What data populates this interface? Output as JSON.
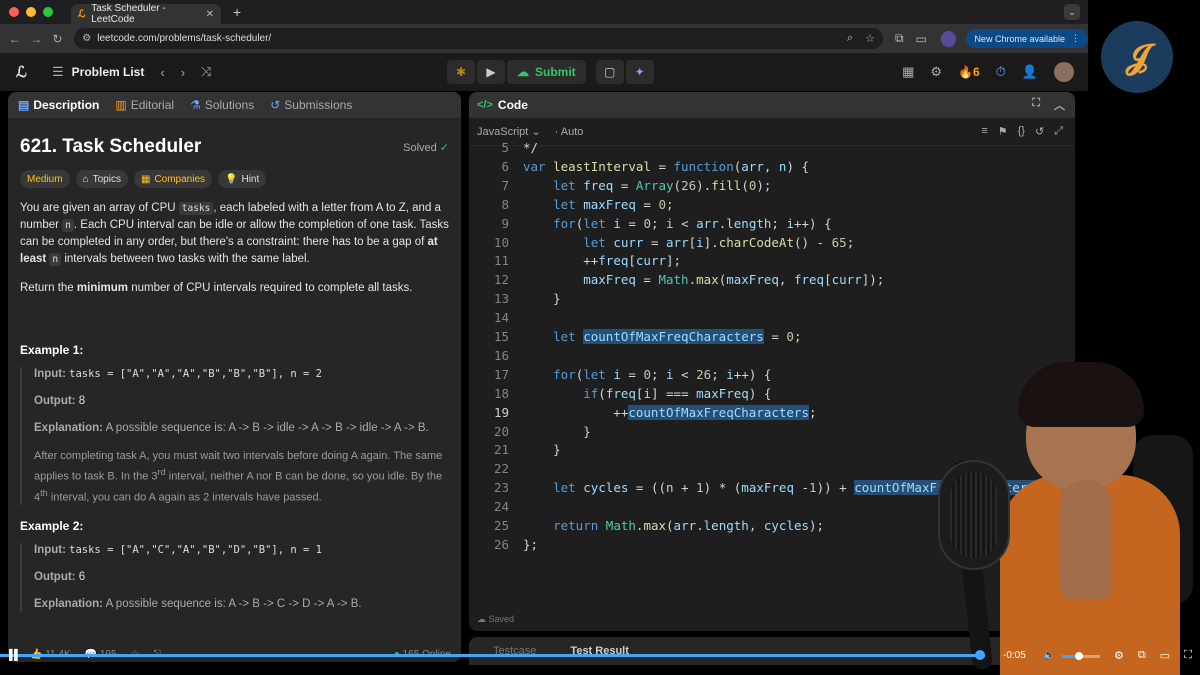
{
  "browser": {
    "tab_title": "Task Scheduler - LeetCode",
    "url": "leetcode.com/problems/task-scheduler/",
    "update_label": "New Chrome available"
  },
  "header": {
    "problem_list_label": "Problem List",
    "submit_label": "Submit",
    "streak_count": "6"
  },
  "left_tabs": [
    "Description",
    "Editorial",
    "Solutions",
    "Submissions"
  ],
  "problem": {
    "title": "621. Task Scheduler",
    "status": "Solved",
    "difficulty": "Medium",
    "topics_label": "Topics",
    "companies_label": "Companies",
    "hint_label": "Hint",
    "p1_a": "You are given an array of CPU ",
    "p1_code1": "tasks",
    "p1_b": ", each labeled with a letter from A to Z, and a number ",
    "p1_code2": "n",
    "p1_c": ". Each CPU interval can be idle or allow the completion of one task. Tasks can be completed in any order, but there's a constraint: there has to be a gap of ",
    "p1_bold": "at least",
    "p1_code3": "n",
    "p1_d": " intervals between two tasks with the same label.",
    "p2_a": "Return the ",
    "p2_bold": "minimum",
    "p2_b": " number of CPU intervals required to complete all tasks.",
    "ex1_head": "Example 1:",
    "ex1_input_label": "Input:",
    "ex1_input": "tasks = [\"A\",\"A\",\"A\",\"B\",\"B\",\"B\"], n = 2",
    "ex1_output_label": "Output:",
    "ex1_output": "8",
    "ex1_expl_label": "Explanation:",
    "ex1_expl": "A possible sequence is: A -> B -> idle -> A -> B -> idle -> A -> B.",
    "ex1_para_a": "After completing task A, you must wait two intervals before doing A again. The same applies to task B. In the 3",
    "ex1_para_sup1": "rd",
    "ex1_para_b": " interval, neither A nor B can be done, so you idle. By the 4",
    "ex1_para_sup2": "th",
    "ex1_para_c": " interval, you can do A again as 2 intervals have passed.",
    "ex2_head": "Example 2:",
    "ex2_input_label": "Input:",
    "ex2_input": "tasks = [\"A\",\"C\",\"A\",\"B\",\"D\",\"B\"], n = 1",
    "ex2_output_label": "Output:",
    "ex2_output": "6",
    "ex2_expl_label": "Explanation:",
    "ex2_expl": "A possible sequence is: A -> B -> C -> D -> A -> B."
  },
  "stats": {
    "likes": "11.4K",
    "comments": "195",
    "online": "165 Online"
  },
  "code_panel": {
    "title": "Code",
    "language": "JavaScript",
    "mode": "Auto",
    "saved_label": "Saved"
  },
  "code_lines": [
    {
      "n": "5",
      "html": "<span class='o'>*/</span>"
    },
    {
      "n": "6",
      "html": "<span class='k'>var</span> <span class='f'>leastInterval</span> = <span class='k'>function</span>(<span class='v'>arr</span>, <span class='v'>n</span>) {"
    },
    {
      "n": "7",
      "html": "    <span class='k'>let</span> <span class='v'>freq</span> = <span class='y'>Array</span>(<span class='n'>26</span>).<span class='f'>fill</span>(<span class='n'>0</span>);"
    },
    {
      "n": "8",
      "html": "    <span class='k'>let</span> <span class='v'>maxFreq</span> = <span class='n'>0</span>;"
    },
    {
      "n": "9",
      "html": "    <span class='k'>for</span>(<span class='k'>let</span> <span class='v'>i</span> = <span class='n'>0</span>; <span class='v'>i</span> &lt; <span class='v'>arr</span>.<span class='v'>length</span>; <span class='v'>i</span>++) {"
    },
    {
      "n": "10",
      "html": "        <span class='k'>let</span> <span class='v'>curr</span> = <span class='v'>arr</span>[<span class='v'>i</span>].<span class='f'>charCodeAt</span>() - <span class='n'>65</span>;"
    },
    {
      "n": "11",
      "html": "        ++<span class='v'>freq</span>[<span class='v'>curr</span>];"
    },
    {
      "n": "12",
      "html": "        <span class='v'>maxFreq</span> = <span class='y'>Math</span>.<span class='f'>max</span>(<span class='v'>maxFreq</span>, <span class='v'>freq</span>[<span class='v'>curr</span>]);"
    },
    {
      "n": "13",
      "html": "    }"
    },
    {
      "n": "14",
      "html": ""
    },
    {
      "n": "15",
      "html": "    <span class='k'>let</span> <span class='v hl'>countOfMaxFreqCharacters</span> = <span class='n'>0</span>;"
    },
    {
      "n": "16",
      "html": ""
    },
    {
      "n": "17",
      "html": "    <span class='k'>for</span>(<span class='k'>let</span> <span class='v'>i</span> = <span class='n'>0</span>; <span class='v'>i</span> &lt; <span class='n'>26</span>; <span class='v'>i</span>++) {"
    },
    {
      "n": "18",
      "html": "        <span class='k'>if</span>(<span class='v'>freq</span>[<span class='v'>i</span>] === <span class='v'>maxFreq</span>) {"
    },
    {
      "n": "19",
      "html": "            ++<span class='v hl'>countOfMaxFreqCharacters</span>;"
    },
    {
      "n": "20",
      "html": "        }"
    },
    {
      "n": "21",
      "html": "    }"
    },
    {
      "n": "22",
      "html": ""
    },
    {
      "n": "23",
      "html": "    <span class='k'>let</span> <span class='v'>cycles</span> = ((<span class='v'>n</span> + <span class='n'>1</span>) * (<span class='v'>maxFreq</span> -<span class='n'>1</span>)) + <span class='v hl'>countOfMaxFreqCharacters</span>;"
    },
    {
      "n": "24",
      "html": ""
    },
    {
      "n": "25",
      "html": "    <span class='k'>return</span> <span class='y'>Math</span>.<span class='f'>max</span>(<span class='v'>arr</span>.<span class='v'>length</span>, <span class='v'>cycles</span>);"
    },
    {
      "n": "26",
      "html": "};"
    }
  ],
  "current_line": "19",
  "bottom_tabs": [
    "Testcase",
    "Test Result"
  ],
  "player": {
    "time_remaining": "-0:05",
    "progress_fraction": 0.995,
    "volume_fraction": 0.45
  },
  "colors": {
    "accent_green": "#35c466",
    "leetcode_orange": "#ffa116",
    "medium_yellow": "#ffc01e",
    "progress_blue": "#3ea6ff"
  }
}
